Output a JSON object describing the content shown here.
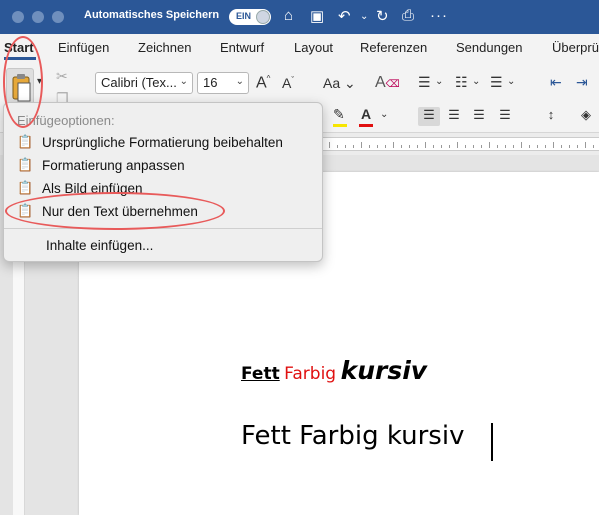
{
  "titlebar": {
    "autosave_label": "Automatisches Speichern",
    "toggle_label": "EIN",
    "more_glyph": "···"
  },
  "tabs": [
    "Start",
    "Einfügen",
    "Zeichnen",
    "Entwurf",
    "Layout",
    "Referenzen",
    "Sendungen",
    "Überprü"
  ],
  "ribbon": {
    "font_name": "Calibri (Tex...",
    "font_size": "16",
    "grow_label": "A",
    "shrink_label": "A",
    "case_label": "Aa",
    "clear_label": "A"
  },
  "paste_menu": {
    "header": "Einfügeoptionen:",
    "items": [
      {
        "label": "Ursprüngliche Formatierung beibehalten",
        "icon": "clipboard-brush-icon"
      },
      {
        "label": "Formatierung anpassen",
        "icon": "clipboard-arrow-icon"
      },
      {
        "label": "Als Bild einfügen",
        "icon": "clipboard-picture-icon"
      },
      {
        "label": "Nur den Text übernehmen",
        "icon": "clipboard-text-icon"
      }
    ],
    "special": "Inhalte einfügen..."
  },
  "document": {
    "line1": {
      "bold": "Fett",
      "red": "Farbig",
      "italic": "kursiv"
    },
    "line2": "Fett Farbig kursiv"
  },
  "colors": {
    "titlebar": "#2b5797",
    "highlight": "#e85a5a",
    "red_text": "#e01010"
  }
}
